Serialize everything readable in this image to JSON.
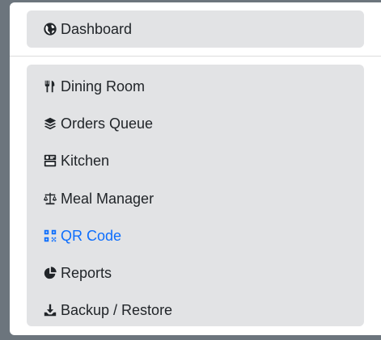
{
  "menu": {
    "dashboard": {
      "label": "Dashboard",
      "icon": "globe-icon"
    },
    "items": [
      {
        "label": "Dining Room",
        "icon": "utensils-icon"
      },
      {
        "label": "Orders Queue",
        "icon": "layers-icon"
      },
      {
        "label": "Kitchen",
        "icon": "kitchen-icon"
      },
      {
        "label": "Meal Manager",
        "icon": "scale-icon"
      },
      {
        "label": "QR Code",
        "icon": "qrcode-icon",
        "active": true
      },
      {
        "label": "Reports",
        "icon": "pie-chart-icon"
      },
      {
        "label": "Backup / Restore",
        "icon": "download-icon"
      }
    ]
  },
  "colors": {
    "background": "#6c757d",
    "panel": "#ffffff",
    "group": "#e2e3e5",
    "text": "#212529",
    "active": "#0d6efd"
  }
}
